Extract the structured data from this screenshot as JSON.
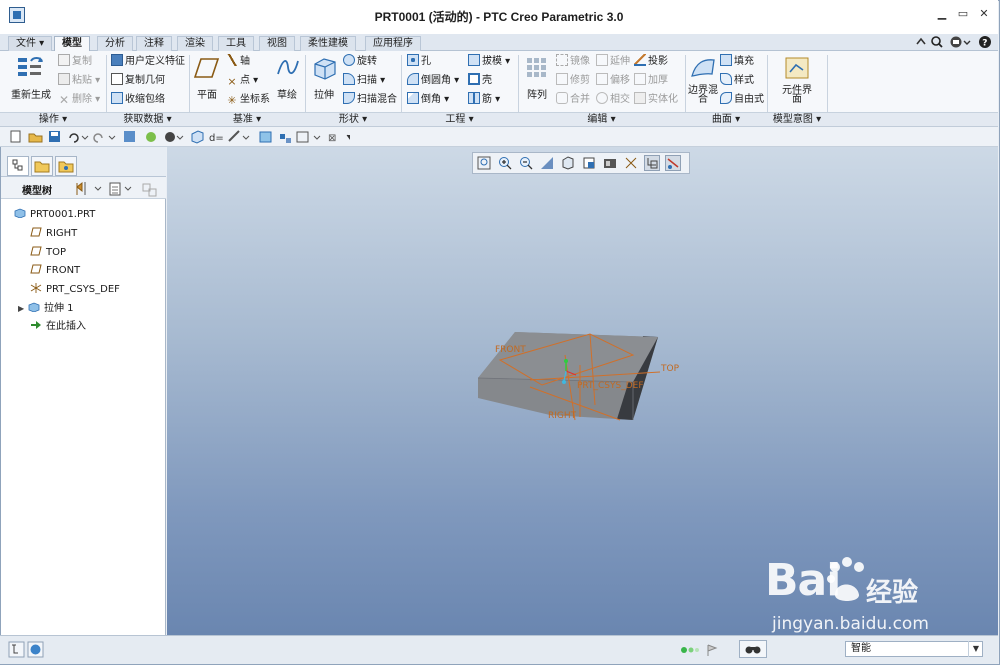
{
  "window": {
    "title": "PRT0001 (活动的) - PTC Creo Parametric 3.0",
    "minimize": "▁",
    "restore": "▭",
    "close": "✕"
  },
  "tabs": [
    {
      "label": "文件 ▾"
    },
    {
      "label": "模型"
    },
    {
      "label": "分析"
    },
    {
      "label": "注释"
    },
    {
      "label": "渲染"
    },
    {
      "label": "工具"
    },
    {
      "label": "视图"
    },
    {
      "label": "柔性建模"
    },
    {
      "label": "应用程序"
    }
  ],
  "ribbon": {
    "ops": {
      "regen": "重新生成",
      "copy": "复制",
      "paste": "粘贴 ▾",
      "delete": "删除 ▾",
      "group": "操作 ▾"
    },
    "getdata": {
      "udf": "用户定义特征",
      "copygeom": "复制几何",
      "shrinkwrap": "收缩包络",
      "group": "获取数据 ▾"
    },
    "datum": {
      "plane": "平面",
      "axis": "轴",
      "point": "点 ▾",
      "csys": "坐标系",
      "sketch": "草绘",
      "group": "基准 ▾"
    },
    "shapes": {
      "extrude": "拉伸",
      "revolve": "旋转",
      "sweep": "扫描 ▾",
      "sweptblend": "扫描混合",
      "group": "形状 ▾"
    },
    "eng": {
      "hole": "孔",
      "round": "倒圆角 ▾",
      "chamfer": "倒角 ▾",
      "draft": "拔模 ▾",
      "shell": "壳",
      "rib": "筋 ▾",
      "group": "工程 ▾"
    },
    "edit": {
      "pattern": "阵列",
      "mirror": "镜像",
      "trim": "修剪",
      "merge": "合并",
      "extend": "延伸",
      "offset": "偏移",
      "intersect": "相交",
      "project": "投影",
      "thicken": "加厚",
      "solidify": "实体化",
      "group": "编辑 ▾"
    },
    "surfaces": {
      "boundary": "边界混合",
      "fill": "填充",
      "style": "样式",
      "freestyle": "自由式",
      "group": "曲面 ▾"
    },
    "intent": {
      "component": "元件界面",
      "group": "模型意图 ▾"
    }
  },
  "panel": {
    "tool": "模型树 ▾"
  },
  "tree": [
    "PRT0001.PRT",
    "RIGHT",
    "TOP",
    "FRONT",
    "PRT_CSYS_DEF",
    "拉伸 1",
    "在此插入"
  ],
  "model_labels": {
    "front": "FRONT",
    "top": "TOP",
    "right": "RIGHT",
    "csys": "PRT_CSYS_DEF"
  },
  "status": {
    "smart": "智能"
  },
  "watermark": {
    "brand": "Bai",
    "site": "经验",
    "url": "jingyan.baidu.com"
  },
  "colors": {
    "accent": "#2f6fb2",
    "datum": "#d07a2a",
    "model": "#85888c"
  }
}
